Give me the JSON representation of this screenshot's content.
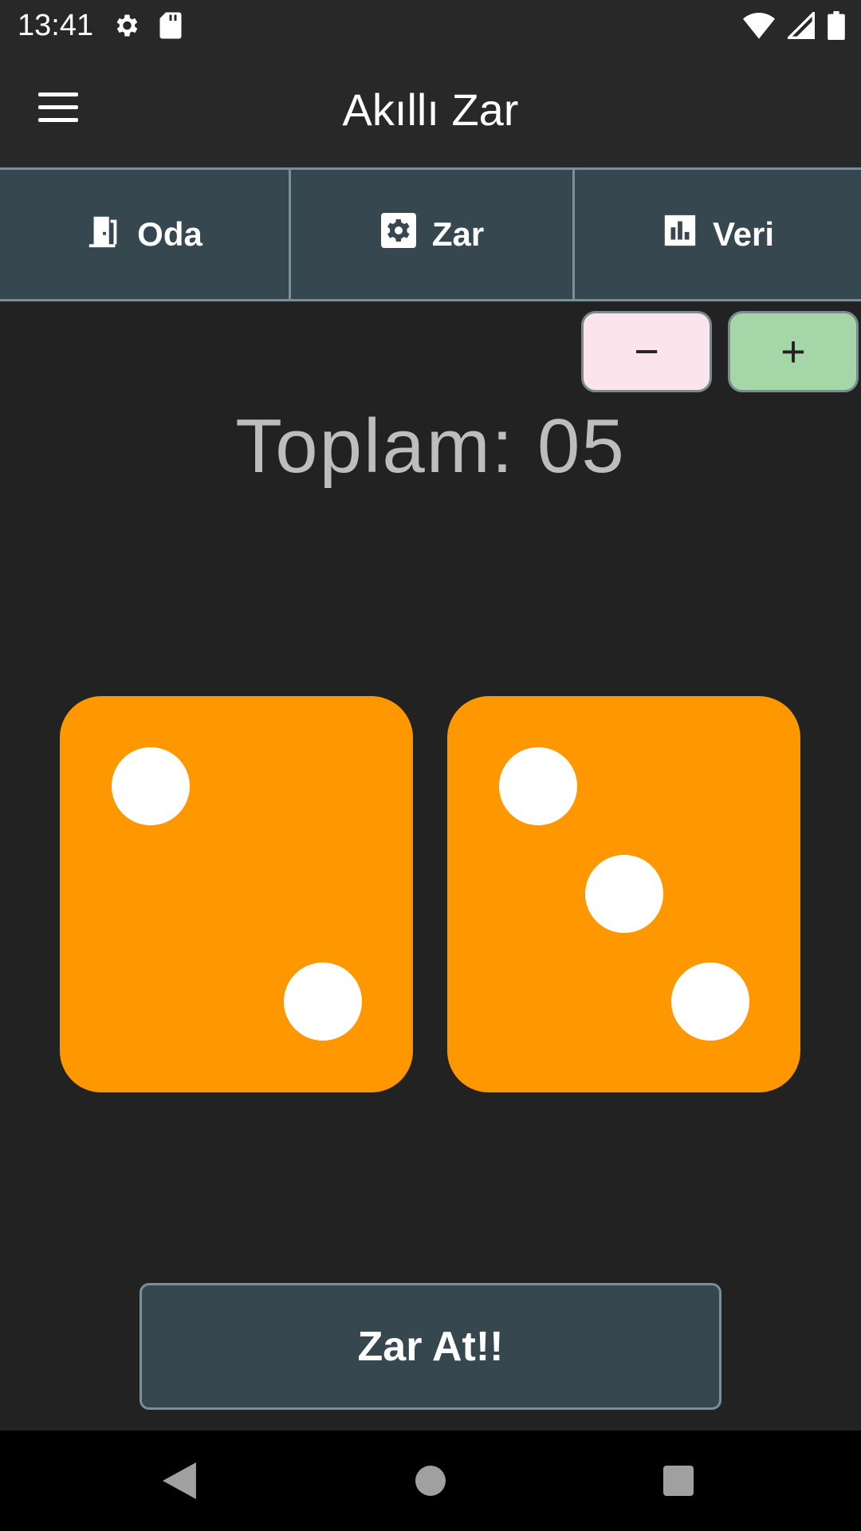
{
  "status_bar": {
    "time": "13:41",
    "icons": [
      "settings-icon",
      "sd-card-icon",
      "wifi-icon",
      "signal-icon",
      "battery-icon"
    ]
  },
  "app_bar": {
    "title": "Akıllı Zar",
    "menu_icon": "menu-icon"
  },
  "tabs": [
    {
      "label": "Oda",
      "icon": "door-icon"
    },
    {
      "label": "Zar",
      "icon": "gear-box-icon"
    },
    {
      "label": "Veri",
      "icon": "bar-chart-icon"
    }
  ],
  "stepper": {
    "minus_label": "−",
    "plus_label": "+"
  },
  "total": {
    "text": "Toplam: 05"
  },
  "dice": [
    {
      "value": 2
    },
    {
      "value": 3
    }
  ],
  "roll_button": {
    "label": "Zar At!!"
  },
  "colors": {
    "background": "#222222",
    "die": "#ff9800",
    "pip": "#ffffff",
    "tab_bg": "#37474f",
    "minus_bg": "#fce4ec",
    "plus_bg": "#a5d6a7"
  }
}
